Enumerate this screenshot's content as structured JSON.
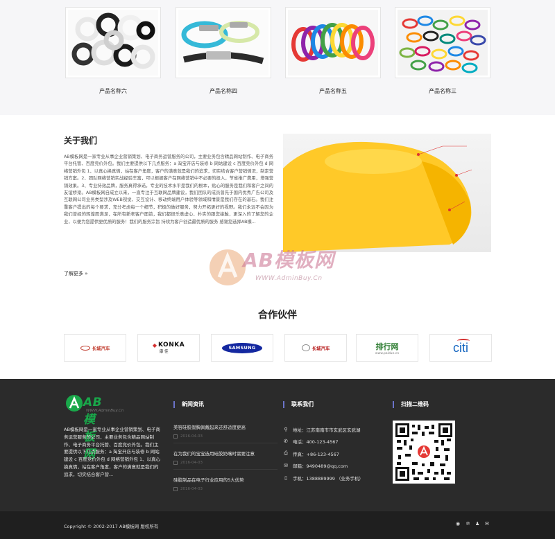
{
  "products": [
    {
      "name": "产品名称六",
      "icon": "silicone-rings-image"
    },
    {
      "name": "产品名称四",
      "icon": "wristband-image"
    },
    {
      "name": "产品名称五",
      "icon": "colored-bracelets-image"
    },
    {
      "name": "产品名称三",
      "icon": "bands-pile-image"
    }
  ],
  "about": {
    "title": "关于我们",
    "text": "AB模板网是一家专业从事企业营销策划、电子商务运营服务的公司，主要业务包含精品网站制作、电子商务平台托管、百度竞价外包。我们主要提供以下几点服务：a 淘宝开店与装修 b 网站建设 c 百度竞价外包 d 网络营销外包 1、以真心换真情，站在客户角度，客户的满意就是我们的追求，切实结合客户营销情况，制定营销方案。2、团队网络营销实战经验丰富，可以根据客户在网络营销中不必要的投入，节省推广费用，增强营销效果。3、专业持效品牌，服务真得承诺，专业的技术水平是我们的根本，贴心的服务是我们和客户之间的友谊桥梁。AB模板网自成立以来，一直专注于互联网品牌建设，我们团队的成员曾先于国内优秀广告公司及互联网公司业务类型涉及WEB视觉、交互设计、移动终端用户体验等领域和情景是我们存在的基石。我们注重客户提出的每个要求，充分考虑每一个细节，积极的做好服务，努力开拓更好的视野。我们永远不会因为我们曾经的辉煌而满足，在所有新老客户面前，我们都很乐意虚心、朴实的跟您接触，更深入的了解您的企业，以便为您提供更优质的服务！我们的服务宗旨 持续为客户创造最优质的服务 感谢您选择AB模...",
    "more": "了解更多 »"
  },
  "watermark": {
    "title": "AB模板网",
    "sub": "WWW.AdminBuy.Cn"
  },
  "partners": {
    "title": "合作伙伴",
    "items": [
      {
        "name": "长城汽车",
        "icon": "greatwall-logo"
      },
      {
        "name": "KONKA",
        "sub": "康 佳",
        "icon": "konka-logo"
      },
      {
        "name": "SAMSUNG",
        "icon": "samsung-logo"
      },
      {
        "name": "长城汽车",
        "icon": "greatwall-auto-logo"
      },
      {
        "name": "排行网",
        "sub": "www.paidue.cn",
        "icon": "paihang-logo"
      },
      {
        "name": "citi",
        "icon": "citi-logo"
      }
    ]
  },
  "footer": {
    "logo": {
      "title": "AB模板网",
      "sub": "WWW.AdminBuy.Cn"
    },
    "intro": "AB模板网是一家专业从事企业营销策划、电子商务运营服务的公司，主要业务包含精品网站制作、电子商务平台托管、百度竞价外包。我们主要提供以下几点服务：a 淘宝开店与装修 b 网站建设 c 百度竞价外包 d 网络营销外包 1、以真心换真情，站在客户角度，客户的满意就是我们的追求，切实结合客户营...",
    "news_title": "新闻资讯",
    "news": [
      {
        "title": "美容硅胶假胸佩戴起来还舒适度更高",
        "date": "2016-04-03"
      },
      {
        "title": "在为我们的宝宝选用硅胶奶嘴时需要注意",
        "date": "2016-04-03"
      },
      {
        "title": "硅胶制品在电子行业应用的5大优势",
        "date": "2016-04-03"
      }
    ],
    "contact_title": "联系我们",
    "contact": [
      {
        "icon": "location-icon",
        "label": "地址：江苏南南市市玄武区玄武湖"
      },
      {
        "icon": "phone-icon",
        "label": "电话：400-123-4567"
      },
      {
        "icon": "fax-icon",
        "label": "传真：+86-123-4567"
      },
      {
        "icon": "mail-icon",
        "label": "邮箱：9490489@qq.com"
      },
      {
        "icon": "mobile-icon",
        "label": "手机：1388889999 （业务手机）"
      }
    ],
    "qr_title": "扫描二维码",
    "copyright": "Copyright © 2002-2017 AB模板网 版权所有",
    "social": [
      "weibo-icon",
      "paypal-icon",
      "qq-icon",
      "email-icon"
    ]
  },
  "colors": {
    "accent": "#6b73c9",
    "brand_green": "#19a84a",
    "footer_bg": "#2b2b2b"
  }
}
